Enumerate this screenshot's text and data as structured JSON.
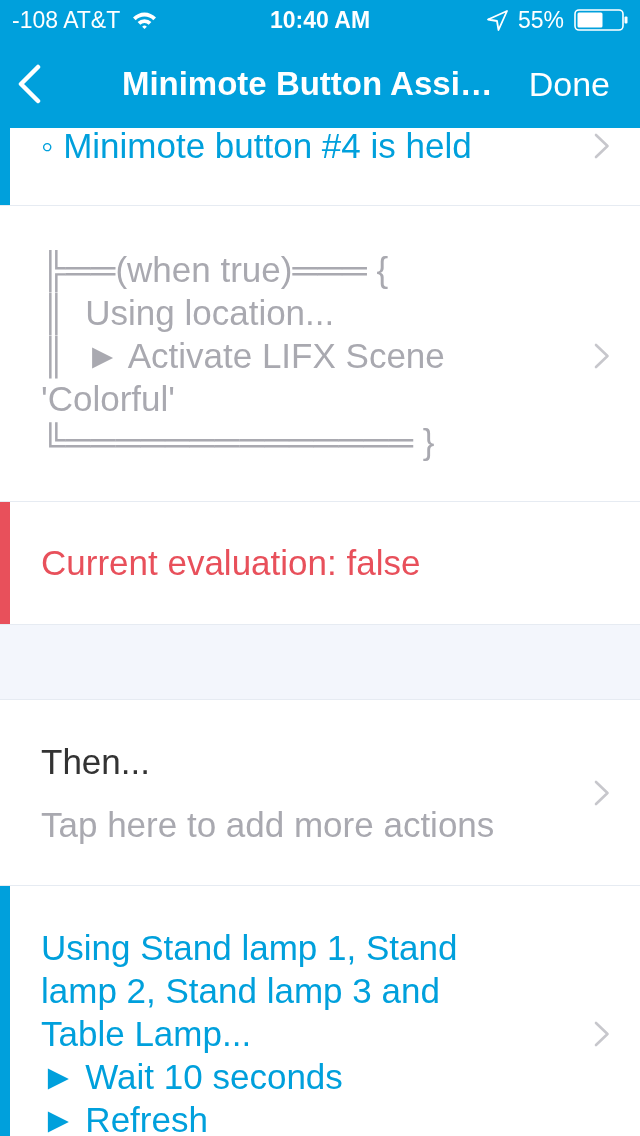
{
  "status_bar": {
    "carrier": "-108 AT&T",
    "time": "10:40 AM",
    "battery": "55%"
  },
  "nav": {
    "title": "Minimote Button Assi…",
    "done": "Done"
  },
  "rows": [
    {
      "kind": "condition",
      "color": "#00a0dc",
      "text": "◦ Minimote button #4 is held"
    },
    {
      "kind": "code",
      "lines": [
        "╠══(when true)═══ {",
        "║  Using location...",
        "║  ► Activate LIFX Scene 'Colorful'",
        "╚══════════════ }"
      ]
    },
    {
      "kind": "evaluation",
      "color": "#e8505b",
      "text": "Current evaluation: false"
    },
    {
      "kind": "spacer"
    },
    {
      "kind": "add",
      "title": "Then...",
      "hint": "Tap here to add more actions"
    },
    {
      "kind": "action",
      "color": "#00a0dc",
      "text": "Using Stand lamp 1, Stand lamp 2, Stand lamp 3 and Table Lamp...",
      "steps": [
        "► Wait 10 seconds",
        "► Refresh"
      ]
    }
  ]
}
